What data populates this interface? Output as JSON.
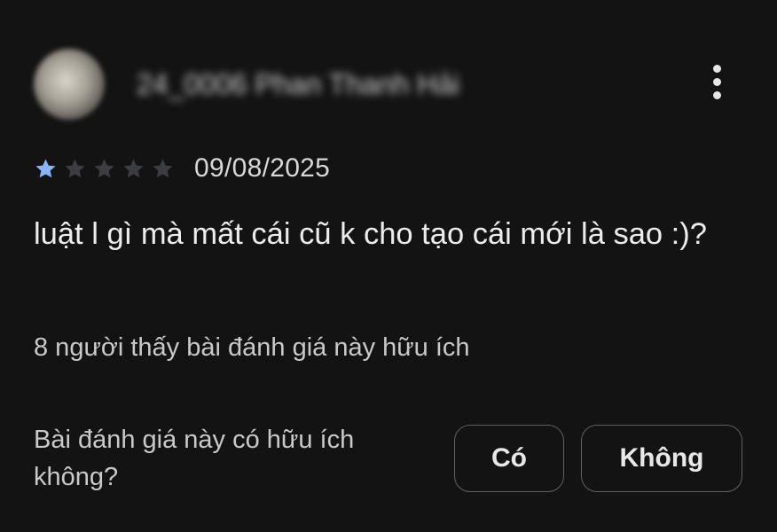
{
  "review": {
    "reviewer_name": "24_0006 Phan Thanh Hải",
    "rating": 1,
    "max_rating": 5,
    "date": "09/08/2025",
    "text": "luật l gì mà mất cái cũ k cho tạo cái mới là sao :)?",
    "helpful_count_text": "8 người thấy bài đánh giá này hữu ích"
  },
  "feedback": {
    "question": "Bài đánh giá này có hữu ích không?",
    "yes_label": "Có",
    "no_label": "Không"
  },
  "icons": {
    "more": "more-vert-icon",
    "star": "star-icon"
  },
  "colors": {
    "background": "#131313",
    "star_filled": "#8ab4f8",
    "star_empty": "#3c3d40",
    "button_border": "#5f6064"
  }
}
